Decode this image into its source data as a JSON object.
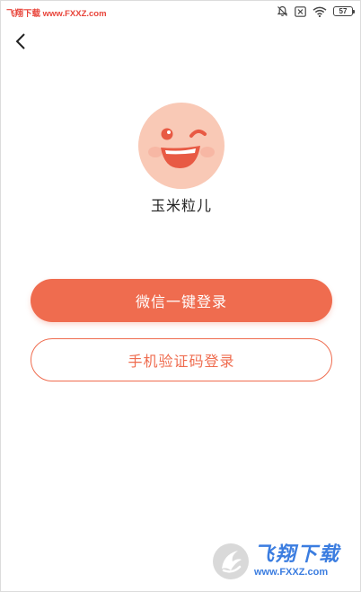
{
  "status_bar": {
    "watermark": "飞翔下载 www.FXXZ.com",
    "battery": "57",
    "icons": [
      "bell-off-icon",
      "close-box-icon",
      "wifi-icon",
      "battery-icon"
    ]
  },
  "nav": {
    "back_icon": "chevron-left-icon"
  },
  "profile": {
    "nickname": "玉米粒儿",
    "avatar_color": "#f9c9b6"
  },
  "actions": {
    "wechat_login": "微信一键登录",
    "phone_login": "手机验证码登录",
    "accent": "#ef6c4f"
  },
  "watermark": {
    "title": "飞翔下载",
    "url": "www.FXXZ.com"
  }
}
